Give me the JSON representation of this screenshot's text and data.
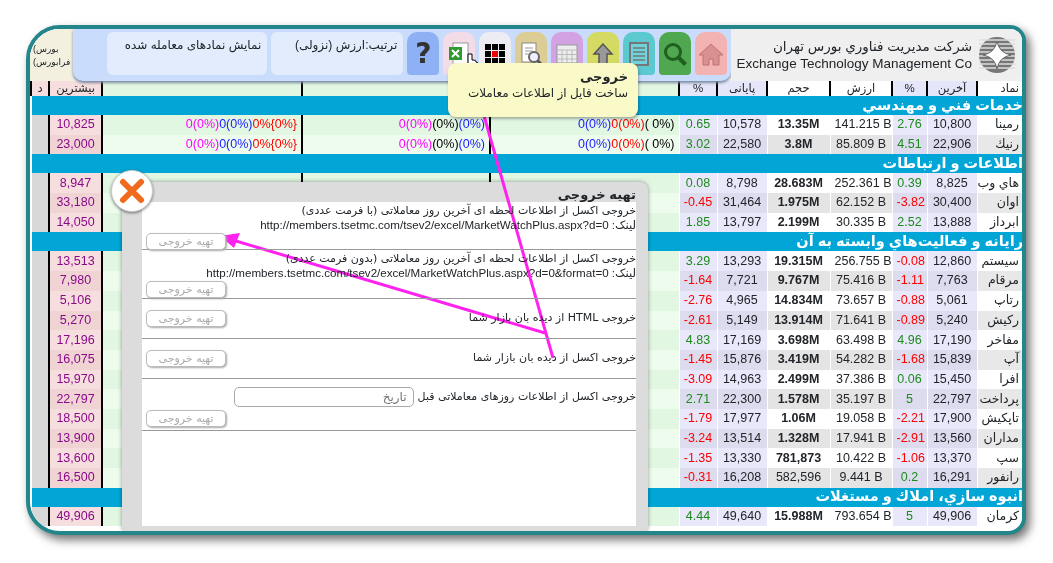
{
  "header": {
    "exchange_tabs": [
      "بورس)",
      "فرابورس)"
    ],
    "filter": "نمایش نمادهای معامله شده",
    "sort": "ترتیب:ارزش (نزولی)",
    "toolbar": [
      {
        "kind": "help",
        "glyph": "?"
      },
      {
        "kind": "excel"
      },
      {
        "kind": "grid"
      },
      {
        "kind": "report"
      },
      {
        "kind": "calendar"
      },
      {
        "kind": "upload"
      },
      {
        "kind": "list"
      },
      {
        "kind": "search"
      },
      {
        "kind": "home"
      }
    ],
    "company": {
      "name_fa": "شرکت مدیریت فناوري بورس تهران",
      "name_en": "Exchange Technology Management Co"
    }
  },
  "tooltip": {
    "title": "خروجی",
    "text": "ساخت فایل از اطلاعات معاملات"
  },
  "table": {
    "columns": [
      {
        "kind": "symbol",
        "label": "نماد"
      },
      {
        "kind": "last",
        "label": "آخرین"
      },
      {
        "kind": "last_change",
        "label": "%"
      },
      {
        "kind": "value",
        "label": "ارزش"
      },
      {
        "kind": "volume",
        "label": "حجم"
      },
      {
        "kind": "close",
        "label": "پایانی"
      },
      {
        "kind": "close_change",
        "label": "%"
      },
      {
        "kind": "mid"
      },
      {
        "kind": "mid"
      },
      {
        "kind": "mid"
      },
      {
        "kind": "high",
        "label": "بیشترین"
      },
      {
        "kind": "edge",
        "label": "د"
      }
    ],
    "groups": [
      {
        "title": "خدمات فني و مهندسي",
        "rows": [
          {
            "symbol": "رمینا",
            "last": "10,800",
            "last_change": "2.76",
            "value": "141.215 B",
            "volume": "13.35M",
            "volume_bold": true,
            "close": "10,578",
            "close_change": "0.65",
            "high": "10,825",
            "mid": [
              [
                "0(0%)",
                "0(0%)",
                "0%{0%}"
              ],
              [
                "0(0%)",
                "(0%)",
                "(0%)"
              ],
              [
                "0(0%)",
                "0(0%)",
                "( 0%)"
              ]
            ]
          },
          {
            "symbol": "رنیك",
            "last": "22,906",
            "last_change": "4.51",
            "value": "85.809 B",
            "volume": "3.8M",
            "volume_bold": true,
            "close": "22,580",
            "close_change": "3.02",
            "high": "23,000",
            "mid": [
              [
                "0(0%)",
                "0(0%)",
                "0%{0%}"
              ],
              [
                "0(0%)",
                "(0%)",
                "(0%)"
              ],
              [
                "0(0%)",
                "0(0%)",
                "( 0%)"
              ]
            ]
          }
        ]
      },
      {
        "title": "اطلاعات و ارتباطات",
        "rows": [
          {
            "symbol": "هاي وب",
            "last": "8,825",
            "last_change": "0.39",
            "value": "252.361 B",
            "volume": "28.683M",
            "volume_bold": true,
            "close": "8,798",
            "close_change": "0.08",
            "high": "8,947"
          },
          {
            "symbol": "اوان",
            "last": "30,400",
            "last_change": "-3.82",
            "value": "62.152 B",
            "volume": "1.975M",
            "volume_bold": true,
            "close": "31,464",
            "close_change": "-0.45",
            "high": "33,180"
          },
          {
            "symbol": "ابرداز",
            "last": "13,888",
            "last_change": "2.52",
            "value": "30.335 B",
            "volume": "2.199M",
            "volume_bold": true,
            "close": "13,797",
            "close_change": "1.85",
            "high": "14,050"
          }
        ]
      },
      {
        "title": "رایانه و فعالیت‌هاي وابسته به آن",
        "rows": [
          {
            "symbol": "سیستم",
            "last": "12,860",
            "last_change": "-0.08",
            "value": "256.755 B",
            "volume": "19.315M",
            "volume_bold": true,
            "close": "13,293",
            "close_change": "3.29",
            "high": "13,513"
          },
          {
            "symbol": "مرقام",
            "last": "7,763",
            "last_change": "-1.11",
            "value": "75.416 B",
            "volume": "9.767M",
            "volume_bold": true,
            "close": "7,721",
            "close_change": "-1.64",
            "high": "7,980"
          },
          {
            "symbol": "رتاپ",
            "last": "5,061",
            "last_change": "-0.88",
            "value": "73.657 B",
            "volume": "14.834M",
            "volume_bold": true,
            "close": "4,965",
            "close_change": "-2.76",
            "high": "5,106"
          },
          {
            "symbol": "رکیش",
            "last": "5,240",
            "last_change": "-0.89",
            "value": "71.641 B",
            "volume": "13.914M",
            "volume_bold": true,
            "close": "5,149",
            "close_change": "-2.61",
            "high": "5,270"
          },
          {
            "symbol": "مفاخر",
            "last": "17,190",
            "last_change": "4.96",
            "value": "63.498 B",
            "volume": "3.698M",
            "volume_bold": true,
            "close": "17,169",
            "close_change": "4.83",
            "high": "17,196"
          },
          {
            "symbol": "آپ",
            "last": "15,839",
            "last_change": "-1.68",
            "value": "54.282 B",
            "volume": "3.419M",
            "volume_bold": true,
            "close": "15,876",
            "close_change": "-1.45",
            "high": "16,075"
          },
          {
            "symbol": "افرا",
            "last": "15,450",
            "last_change": "0.06",
            "value": "37.386 B",
            "volume": "2.499M",
            "volume_bold": true,
            "close": "14,963",
            "close_change": "-3.09",
            "high": "15,970"
          },
          {
            "symbol": "پرداخت",
            "last": "22,797",
            "last_change": "5",
            "value": "35.197 B",
            "volume": "1.578M",
            "volume_bold": true,
            "close": "22,300",
            "close_change": "2.71",
            "high": "22,797"
          },
          {
            "symbol": "تاپکیش",
            "last": "17,900",
            "last_change": "-2.21",
            "value": "19.058 B",
            "volume": "1.06M",
            "volume_bold": true,
            "close": "17,977",
            "close_change": "-1.79",
            "high": "18,500"
          },
          {
            "symbol": "مداران",
            "last": "13,560",
            "last_change": "-2.91",
            "value": "17.941 B",
            "volume": "1.328M",
            "volume_bold": true,
            "close": "13,514",
            "close_change": "-3.24",
            "high": "13,900"
          },
          {
            "symbol": "سپ",
            "last": "13,370",
            "last_change": "-1.06",
            "value": "10.422 B",
            "volume": "781,873",
            "volume_bold": true,
            "close": "13,330",
            "close_change": "-1.35",
            "high": "13,600"
          },
          {
            "symbol": "رانفور",
            "last": "16,291",
            "last_change": "0.2",
            "value": "9.441 B",
            "volume": "582,596",
            "volume_bold": false,
            "close": "16,208",
            "close_change": "-0.31",
            "high": "16,500"
          }
        ]
      },
      {
        "title": "انبوه سازي، املاك و مستغلات",
        "rows": [
          {
            "symbol": "کرمان",
            "last": "49,906",
            "last_change": "5",
            "value": "793.654 B",
            "volume": "15.988M",
            "volume_bold": true,
            "close": "49,640",
            "close_change": "4.44",
            "high": "49,906"
          }
        ]
      }
    ]
  },
  "dialog": {
    "title": "تهیه خروجی",
    "sections": [
      {
        "kind": "link",
        "text": "خروجی اکسل از اطلاعات لحظه ای آخرین روز معاملاتی (با فرمت عددی)",
        "link": "لینک: http://members.tsetmc.com/tsev2/excel/MarketWatchPlus.aspx?d=0",
        "button": "تهیه خروجی",
        "disabled": true
      },
      {
        "kind": "link",
        "text": "خروجی اکسل از اطلاعات لحظه ای آخرین روز معاملاتی (بدون فرمت عددی)",
        "link": "لینک: http://members.tsetmc.com/tsev2/excel/MarketWatchPlus.aspx?d=0&format=0",
        "button": "تهیه خروجی",
        "disabled": true
      },
      {
        "kind": "plain",
        "text": "خروجی HTML از دیده بان بازار شما",
        "button": "تهیه خروجی",
        "disabled": true
      },
      {
        "kind": "plain",
        "text": "خروجی اکسل از دیده بان بازار شما",
        "button": "تهیه خروجی",
        "disabled": true
      },
      {
        "kind": "date",
        "text": "خروجی اکسل از اطلاعات روزهای معاملاتی قبل",
        "placeholder": "تاریخ",
        "button": "تهیه خروجی",
        "disabled": true
      }
    ]
  }
}
